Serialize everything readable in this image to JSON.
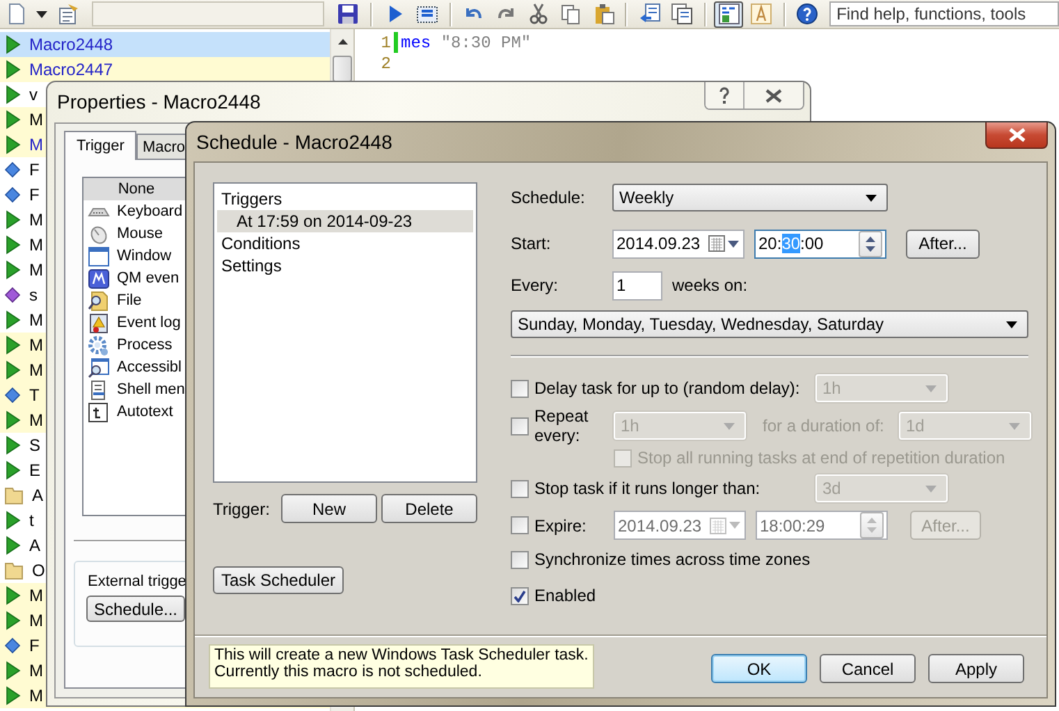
{
  "toolbar": {
    "items": [
      {
        "kind": "new",
        "pressed": false
      },
      {
        "kind": "dropdown",
        "pressed": false
      },
      {
        "kind": "properties",
        "pressed": false
      },
      {
        "kind": "field"
      },
      {
        "kind": "save",
        "pressed": false
      },
      {
        "kind": "separator"
      },
      {
        "kind": "run",
        "pressed": false
      },
      {
        "kind": "record",
        "pressed": false
      },
      {
        "kind": "separator"
      },
      {
        "kind": "undo",
        "pressed": false
      },
      {
        "kind": "redo",
        "pressed": false
      },
      {
        "kind": "cut",
        "pressed": false
      },
      {
        "kind": "copy",
        "pressed": false
      },
      {
        "kind": "paste",
        "pressed": false
      },
      {
        "kind": "separator"
      },
      {
        "kind": "back",
        "pressed": false
      },
      {
        "kind": "windows",
        "pressed": false
      },
      {
        "kind": "separator"
      },
      {
        "kind": "codeview",
        "pressed": true
      },
      {
        "kind": "textstyle",
        "pressed": false
      },
      {
        "kind": "separator"
      },
      {
        "kind": "help",
        "pressed": false
      }
    ],
    "search": {
      "placeholder": "Find help, functions, tools"
    }
  },
  "macro_list": {
    "items": [
      {
        "label": "Macro2448",
        "kind": "macro",
        "selected": true,
        "highlighted": false,
        "color": "#2323c8"
      },
      {
        "label": "Macro2447",
        "kind": "macro",
        "selected": false,
        "highlighted": true,
        "color": "#2323c8"
      },
      {
        "label": "v",
        "kind": "macro",
        "selected": false,
        "highlighted": false,
        "color": "#000000"
      },
      {
        "label": "M",
        "kind": "macro",
        "selected": false,
        "highlighted": true,
        "color": "#000000"
      },
      {
        "label": "M",
        "kind": "macro",
        "selected": false,
        "highlighted": true,
        "color": "#2323c8"
      },
      {
        "label": "F",
        "kind": "function",
        "selected": false,
        "highlighted": false,
        "color": "#000000"
      },
      {
        "label": "F",
        "kind": "function",
        "selected": false,
        "highlighted": false,
        "color": "#000000"
      },
      {
        "label": "M",
        "kind": "macro",
        "selected": false,
        "highlighted": false,
        "color": "#000000"
      },
      {
        "label": "M",
        "kind": "macro",
        "selected": false,
        "highlighted": false,
        "color": "#000000"
      },
      {
        "label": "M",
        "kind": "macro",
        "selected": false,
        "highlighted": false,
        "color": "#000000"
      },
      {
        "label": "s",
        "kind": "member",
        "selected": false,
        "highlighted": false,
        "color": "#000000"
      },
      {
        "label": "M",
        "kind": "macro",
        "selected": false,
        "highlighted": false,
        "color": "#000000"
      },
      {
        "label": "M",
        "kind": "macro",
        "selected": false,
        "highlighted": true,
        "color": "#000000"
      },
      {
        "label": "M",
        "kind": "macro",
        "selected": false,
        "highlighted": true,
        "color": "#000000"
      },
      {
        "label": "T",
        "kind": "function",
        "selected": false,
        "highlighted": true,
        "color": "#000000"
      },
      {
        "label": "M",
        "kind": "macro",
        "selected": false,
        "highlighted": true,
        "color": "#000000"
      },
      {
        "label": "S",
        "kind": "macro",
        "selected": false,
        "highlighted": false,
        "color": "#000000"
      },
      {
        "label": "E",
        "kind": "macro",
        "selected": false,
        "highlighted": false,
        "color": "#000000"
      },
      {
        "label": "A",
        "kind": "folder",
        "selected": false,
        "highlighted": false,
        "color": "#000000"
      },
      {
        "label": "t",
        "kind": "macro",
        "selected": false,
        "highlighted": false,
        "color": "#000000"
      },
      {
        "label": "A",
        "kind": "macro",
        "selected": false,
        "highlighted": false,
        "color": "#000000"
      },
      {
        "label": "O",
        "kind": "folder",
        "selected": false,
        "highlighted": false,
        "color": "#000000"
      },
      {
        "label": "M",
        "kind": "macro",
        "selected": false,
        "highlighted": true,
        "color": "#000000"
      },
      {
        "label": "M",
        "kind": "macro",
        "selected": false,
        "highlighted": true,
        "color": "#000000"
      },
      {
        "label": "F",
        "kind": "function",
        "selected": false,
        "highlighted": true,
        "color": "#000000"
      },
      {
        "label": "M",
        "kind": "macro",
        "selected": false,
        "highlighted": true,
        "color": "#000000"
      },
      {
        "label": "M",
        "kind": "macro",
        "selected": false,
        "highlighted": true,
        "color": "#000000"
      }
    ]
  },
  "editor": {
    "lines": [
      {
        "number": "1",
        "modified": true,
        "tokens": [
          {
            "kind": "keyword",
            "text": "mes"
          },
          {
            "kind": "string",
            "text": "\"8:30 PM\""
          }
        ]
      },
      {
        "number": "2",
        "modified": false
      }
    ]
  },
  "properties_window": {
    "title": "Properties - Macro2448",
    "tabs": [
      {
        "label": "Trigger",
        "selected": true
      },
      {
        "label": "Macro",
        "selected": false
      }
    ],
    "triggers": [
      {
        "label": "None",
        "kind": "none",
        "selected": true
      },
      {
        "label": "Keyboard",
        "kind": "keyboard",
        "selected": false
      },
      {
        "label": "Mouse",
        "kind": "mouse",
        "selected": false
      },
      {
        "label": "Window",
        "kind": "window",
        "selected": false
      },
      {
        "label": "QM even",
        "kind": "qm",
        "selected": false
      },
      {
        "label": "File",
        "kind": "file",
        "selected": false
      },
      {
        "label": "Event log",
        "kind": "log",
        "selected": false
      },
      {
        "label": "Process",
        "kind": "process",
        "selected": false
      },
      {
        "label": "Accessibl",
        "kind": "accessible",
        "selected": false
      },
      {
        "label": "Shell men",
        "kind": "shell",
        "selected": false
      },
      {
        "label": "Autotext",
        "kind": "autotext",
        "selected": false
      }
    ],
    "external_trigger": {
      "label": "External trigge",
      "button": "Schedule..."
    }
  },
  "schedule_window": {
    "title": "Schedule - Macro2448",
    "tree": [
      {
        "label": "Triggers",
        "selected": false,
        "children": [
          {
            "label": "At 17:59 on 2014-09-23",
            "selected": true
          }
        ]
      },
      {
        "label": "Conditions",
        "selected": false
      },
      {
        "label": "Settings",
        "selected": false
      }
    ],
    "trigger_label": "Trigger:",
    "trigger_buttons": [
      "New",
      "Delete"
    ],
    "task_scheduler_button": "Task Scheduler",
    "schedule": {
      "label": "Schedule:",
      "value": "Weekly"
    },
    "start": {
      "label": "Start:",
      "date": "2014.09.23",
      "time_parts": [
        {
          "text": "20:",
          "selected": false
        },
        {
          "text": "30",
          "selected": true
        },
        {
          "text": ":00",
          "selected": false
        }
      ],
      "after_button": "After..."
    },
    "every": {
      "label": "Every:",
      "value": "1",
      "unit": "weeks on:"
    },
    "days": "Sunday, Monday, Tuesday, Wednesday, Saturday",
    "delay": {
      "label": "Delay task for up to (random delay):",
      "checked": false,
      "value": "1h",
      "disabled": true
    },
    "repeat": {
      "label": "Repeat every:",
      "checked": false,
      "value": "1h",
      "disabled": true,
      "duration_label": "for a duration of:",
      "duration": "1d"
    },
    "stop_all": {
      "label": "Stop all running tasks at end of repetition duration",
      "checked": false,
      "disabled": true
    },
    "stop_task": {
      "label": "Stop task if it runs longer than:",
      "checked": false,
      "value": "3d",
      "disabled": true
    },
    "expire": {
      "label": "Expire:",
      "checked": false,
      "date": "2014.09.23",
      "time": "18:00:29",
      "after_button": "After...",
      "disabled": true
    },
    "sync": {
      "label": "Synchronize times across time zones",
      "checked": false
    },
    "enabled": {
      "label": "Enabled",
      "checked": true
    },
    "info": [
      "This will create a new Windows Task Scheduler task.",
      "Currently this macro is not scheduled."
    ],
    "buttons": [
      {
        "label": "OK",
        "default": true
      },
      {
        "label": "Cancel",
        "default": false
      },
      {
        "label": "Apply",
        "default": false
      }
    ]
  }
}
